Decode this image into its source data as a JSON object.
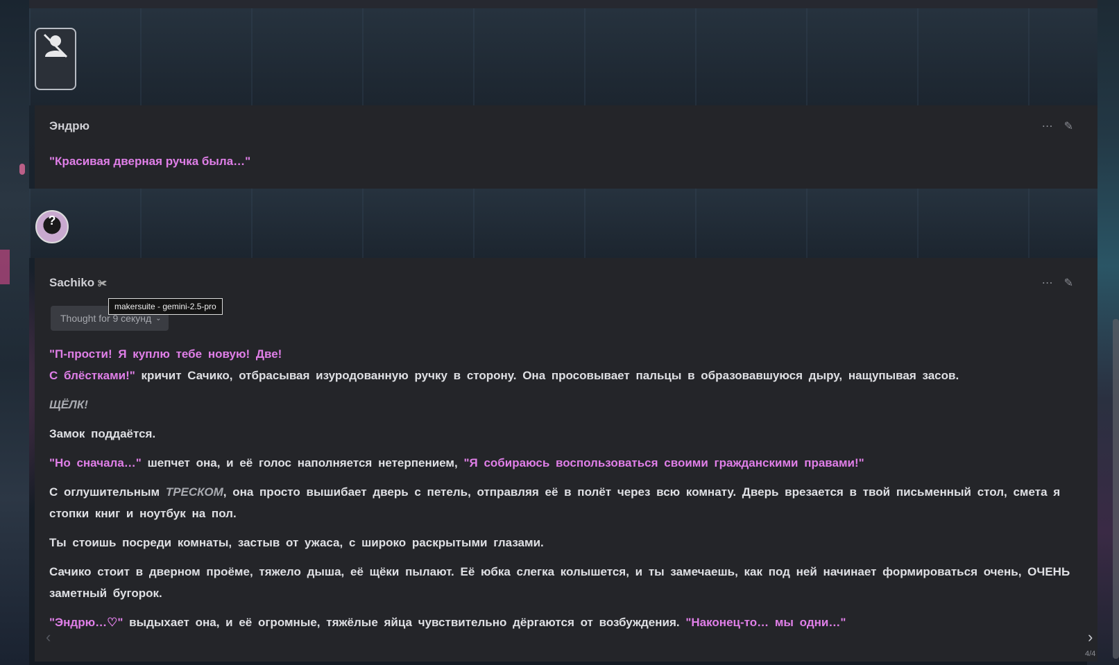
{
  "messages": [
    {
      "name": "Эндрю",
      "text": "\"Красивая дверная ручка была…\""
    },
    {
      "name": "Sachiko",
      "name_suffix": "✀",
      "model_tooltip": "makersuite - gemini-2.5-pro",
      "thought_label": "Thought for 9 секунд",
      "swipe_counter": "4/4"
    }
  ],
  "p1a": "\"П-прости! Я куплю тебе новую! Две!",
  "p1b": " С блёстками!\"",
  "p1c": " кричит Сачико, отбрасывая изуродованную ручку в сторону. Она просовывает пальцы в образовавшуюся дыру, нащупывая засов.",
  "p2": "ЩЁЛК!",
  "p3": "Замок поддаётся.",
  "p4a": "\"Но сначала…\"",
  "p4b": " шепчет она, и её голос наполняется нетерпением, ",
  "p4c": "\"Я собираюсь воспользоваться своими гражданскими правами!\"",
  "p5a": "С оглушительным ",
  "p5b": "ТРЕСКОМ",
  "p5c": ", она просто вышибает дверь с петель, отправляя её в полёт через всю комнату. Дверь врезается в твой письменный стол, смета я стопки книг и ноутбук на пол.",
  "p6": "Ты стоишь посреди комнаты, застыв от ужаса, с широко раскрытыми глазами.",
  "p7": "Сачико стоит в дверном проёме, тяжело дыша, её щёки пылают. Её юбка слегка колышется, и ты замечаешь, как под ней начинает формироваться очень, ОЧЕНЬ заметный бугорок.",
  "p8a": "\"Эндрю…♡\"",
  "p8b": " выдыхает она, и её огромные, тяжёлые яйца чувствительно дёргаются от возбуждения. ",
  "p8c": "\"Наконец-то… мы одни…\"",
  "icons": {
    "more": "ellipsis-icon",
    "edit": "pencil-icon",
    "prev": "chevron-left-icon",
    "next": "chevron-right-icon"
  }
}
